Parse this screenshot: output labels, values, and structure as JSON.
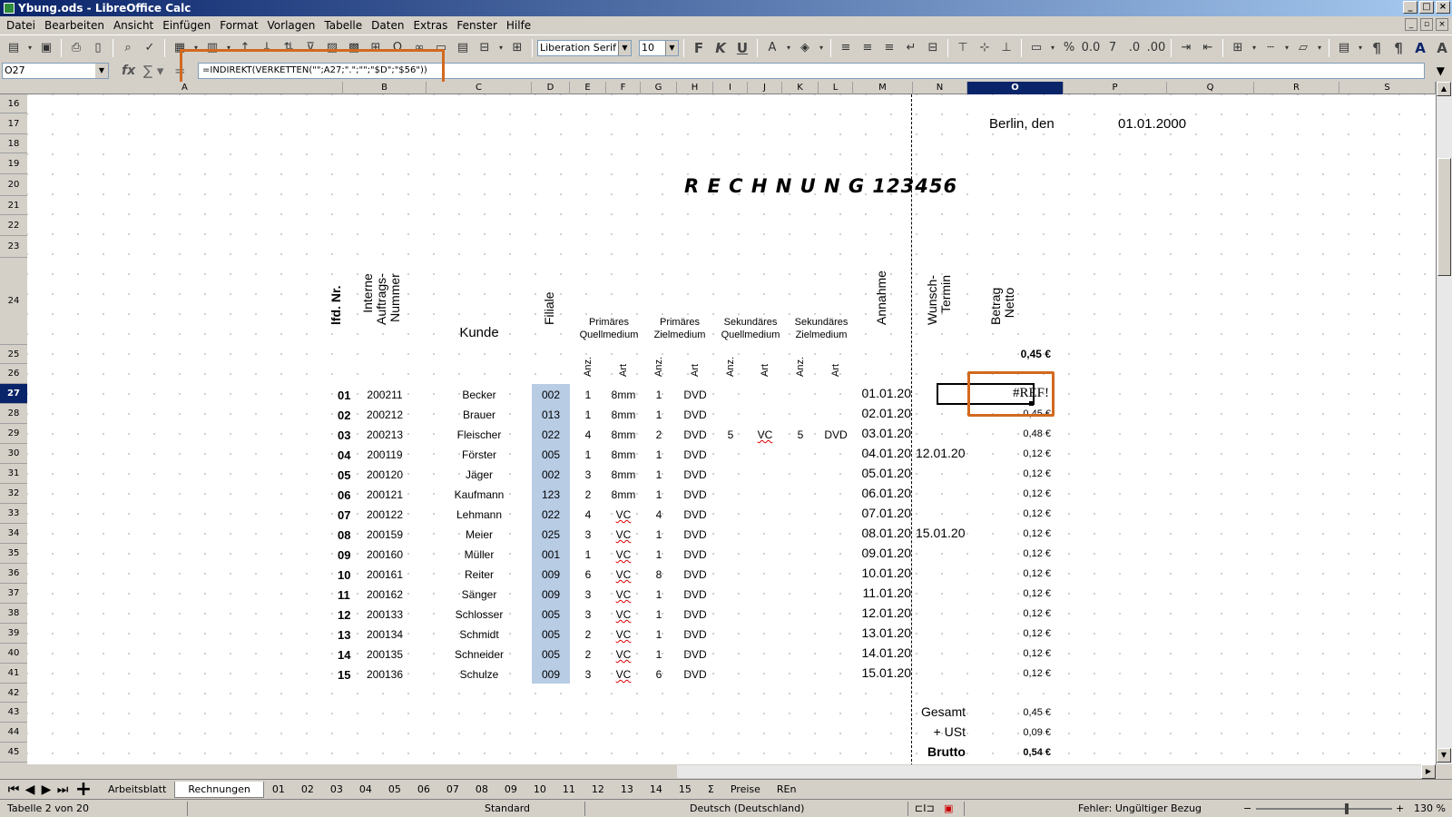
{
  "window": {
    "title": "Ybung.ods - LibreOffice Calc",
    "btn_min": "_",
    "btn_max": "□",
    "btn_close": "×"
  },
  "menu": [
    "Datei",
    "Bearbeiten",
    "Ansicht",
    "Einfügen",
    "Format",
    "Vorlagen",
    "Tabelle",
    "Daten",
    "Extras",
    "Fenster",
    "Hilfe"
  ],
  "toolbar": {
    "font_name": "Liberation Serif",
    "font_size": "10"
  },
  "formula_bar": {
    "cell_ref": "O27",
    "formula": "=INDIREKT(VERKETTEN(\"\";A27;\".\";\"\";\"$D\";\"$56\"))"
  },
  "columns": [
    "A",
    "B",
    "C",
    "D",
    "E",
    "F",
    "G",
    "H",
    "I",
    "J",
    "K",
    "L",
    "M",
    "N",
    "O",
    "P",
    "Q",
    "R",
    "S"
  ],
  "selected_column": "O",
  "rows": [
    "16",
    "17",
    "18",
    "19",
    "20",
    "21",
    "22",
    "23",
    "24",
    "25",
    "26",
    "27",
    "28",
    "29",
    "30",
    "31",
    "32",
    "33",
    "34",
    "35",
    "36",
    "37",
    "38",
    "39",
    "40",
    "41",
    "42",
    "43",
    "44",
    "45"
  ],
  "selected_row": "27",
  "sheet": {
    "place_label": "Berlin, den",
    "date": "01.01.2000",
    "invoice_title": "R E C H N U N G    123456",
    "headers": {
      "lfd_nr": "lfd. Nr.",
      "auftrag": "Interne\nAuftrags-\nNummer",
      "kunde": "Kunde",
      "filiale": "Filiale",
      "annahme": "Annahme",
      "wunsch": "Wunsch-\nTermin",
      "betrag": "Betrag\nNetto",
      "prim_quell": "Primäres\nQuellmedium",
      "prim_ziel": "Primäres\nZielmedium",
      "sek_quell": "Sekundäres\nQuellmedium",
      "sek_ziel": "Sekundäres\nZielmedium",
      "anz": "Anz.",
      "art": "Art"
    },
    "total_top": "0,45 €",
    "error_value": "#REF!",
    "rows": [
      {
        "nr": "01",
        "auftrag": "200211",
        "kunde": "Becker",
        "filiale": "002",
        "pa": "1",
        "part": "8mm",
        "za": "1",
        "zart": "DVD",
        "sqa": "",
        "sqart": "",
        "sza": "",
        "szart": "",
        "annahme": "01.01.20",
        "wunsch": "",
        "betrag": ""
      },
      {
        "nr": "02",
        "auftrag": "200212",
        "kunde": "Brauer",
        "filiale": "013",
        "pa": "1",
        "part": "8mm",
        "za": "1",
        "zart": "DVD",
        "sqa": "",
        "sqart": "",
        "sza": "",
        "szart": "",
        "annahme": "02.01.20",
        "wunsch": "",
        "betrag": "0,45 €"
      },
      {
        "nr": "03",
        "auftrag": "200213",
        "kunde": "Fleischer",
        "filiale": "022",
        "pa": "4",
        "part": "8mm",
        "za": "2",
        "zart": "DVD",
        "sqa": "5",
        "sqart": "VC",
        "sza": "5",
        "szart": "DVD",
        "annahme": "03.01.20",
        "wunsch": "",
        "betrag": "0,48 €"
      },
      {
        "nr": "04",
        "auftrag": "200119",
        "kunde": "Förster",
        "filiale": "005",
        "pa": "1",
        "part": "8mm",
        "za": "1",
        "zart": "DVD",
        "sqa": "",
        "sqart": "",
        "sza": "",
        "szart": "",
        "annahme": "04.01.20",
        "wunsch": "12.01.20",
        "betrag": "0,12 €"
      },
      {
        "nr": "05",
        "auftrag": "200120",
        "kunde": "Jäger",
        "filiale": "002",
        "pa": "3",
        "part": "8mm",
        "za": "1",
        "zart": "DVD",
        "sqa": "",
        "sqart": "",
        "sza": "",
        "szart": "",
        "annahme": "05.01.20",
        "wunsch": "",
        "betrag": "0,12 €"
      },
      {
        "nr": "06",
        "auftrag": "200121",
        "kunde": "Kaufmann",
        "filiale": "123",
        "pa": "2",
        "part": "8mm",
        "za": "1",
        "zart": "DVD",
        "sqa": "",
        "sqart": "",
        "sza": "",
        "szart": "",
        "annahme": "06.01.20",
        "wunsch": "",
        "betrag": "0,12 €"
      },
      {
        "nr": "07",
        "auftrag": "200122",
        "kunde": "Lehmann",
        "filiale": "022",
        "pa": "4",
        "part": "VC",
        "za": "4",
        "zart": "DVD",
        "sqa": "",
        "sqart": "",
        "sza": "",
        "szart": "",
        "annahme": "07.01.20",
        "wunsch": "",
        "betrag": "0,12 €"
      },
      {
        "nr": "08",
        "auftrag": "200159",
        "kunde": "Meier",
        "filiale": "025",
        "pa": "3",
        "part": "VC",
        "za": "1",
        "zart": "DVD",
        "sqa": "",
        "sqart": "",
        "sza": "",
        "szart": "",
        "annahme": "08.01.20",
        "wunsch": "15.01.20",
        "betrag": "0,12 €"
      },
      {
        "nr": "09",
        "auftrag": "200160",
        "kunde": "Müller",
        "filiale": "001",
        "pa": "1",
        "part": "VC",
        "za": "1",
        "zart": "DVD",
        "sqa": "",
        "sqart": "",
        "sza": "",
        "szart": "",
        "annahme": "09.01.20",
        "wunsch": "",
        "betrag": "0,12 €"
      },
      {
        "nr": "10",
        "auftrag": "200161",
        "kunde": "Reiter",
        "filiale": "009",
        "pa": "6",
        "part": "VC",
        "za": "8",
        "zart": "DVD",
        "sqa": "",
        "sqart": "",
        "sza": "",
        "szart": "",
        "annahme": "10.01.20",
        "wunsch": "",
        "betrag": "0,12 €"
      },
      {
        "nr": "11",
        "auftrag": "200162",
        "kunde": "Sänger",
        "filiale": "009",
        "pa": "3",
        "part": "VC",
        "za": "1",
        "zart": "DVD",
        "sqa": "",
        "sqart": "",
        "sza": "",
        "szart": "",
        "annahme": "11.01.20",
        "wunsch": "",
        "betrag": "0,12 €"
      },
      {
        "nr": "12",
        "auftrag": "200133",
        "kunde": "Schlosser",
        "filiale": "005",
        "pa": "3",
        "part": "VC",
        "za": "1",
        "zart": "DVD",
        "sqa": "",
        "sqart": "",
        "sza": "",
        "szart": "",
        "annahme": "12.01.20",
        "wunsch": "",
        "betrag": "0,12 €"
      },
      {
        "nr": "13",
        "auftrag": "200134",
        "kunde": "Schmidt",
        "filiale": "005",
        "pa": "2",
        "part": "VC",
        "za": "1",
        "zart": "DVD",
        "sqa": "",
        "sqart": "",
        "sza": "",
        "szart": "",
        "annahme": "13.01.20",
        "wunsch": "",
        "betrag": "0,12 €"
      },
      {
        "nr": "14",
        "auftrag": "200135",
        "kunde": "Schneider",
        "filiale": "005",
        "pa": "2",
        "part": "VC",
        "za": "1",
        "zart": "DVD",
        "sqa": "",
        "sqart": "",
        "sza": "",
        "szart": "",
        "annahme": "14.01.20",
        "wunsch": "",
        "betrag": "0,12 €"
      },
      {
        "nr": "15",
        "auftrag": "200136",
        "kunde": "Schulze",
        "filiale": "009",
        "pa": "3",
        "part": "VC",
        "za": "6",
        "zart": "DVD",
        "sqa": "",
        "sqart": "",
        "sza": "",
        "szart": "",
        "annahme": "15.01.20",
        "wunsch": "",
        "betrag": "0,12 €"
      }
    ],
    "summary": [
      {
        "label": "Gesamt",
        "value": "0,45 €",
        "bold": false
      },
      {
        "label": "+ USt",
        "value": "0,09 €",
        "bold": false
      },
      {
        "label": "Brutto",
        "value": "0,54 €",
        "bold": true
      }
    ]
  },
  "sheet_tabs": [
    "Arbeitsblatt",
    "Rechnungen",
    "01",
    "02",
    "03",
    "04",
    "05",
    "06",
    "07",
    "08",
    "09",
    "10",
    "11",
    "12",
    "13",
    "14",
    "15",
    "Σ",
    "Preise",
    "REn"
  ],
  "active_tab": "Rechnungen",
  "status": {
    "sheet_pos": "Tabelle 2 von 20",
    "style": "Standard",
    "language": "Deutsch (Deutschland)",
    "error": "Fehler: Ungültiger Bezug",
    "zoom": "130 %",
    "zoom_minus": "−",
    "zoom_plus": "+"
  },
  "colors": {
    "selection": "#0a246a",
    "highlight": "#d2691e",
    "filiale_fill": "#b8cce4"
  }
}
